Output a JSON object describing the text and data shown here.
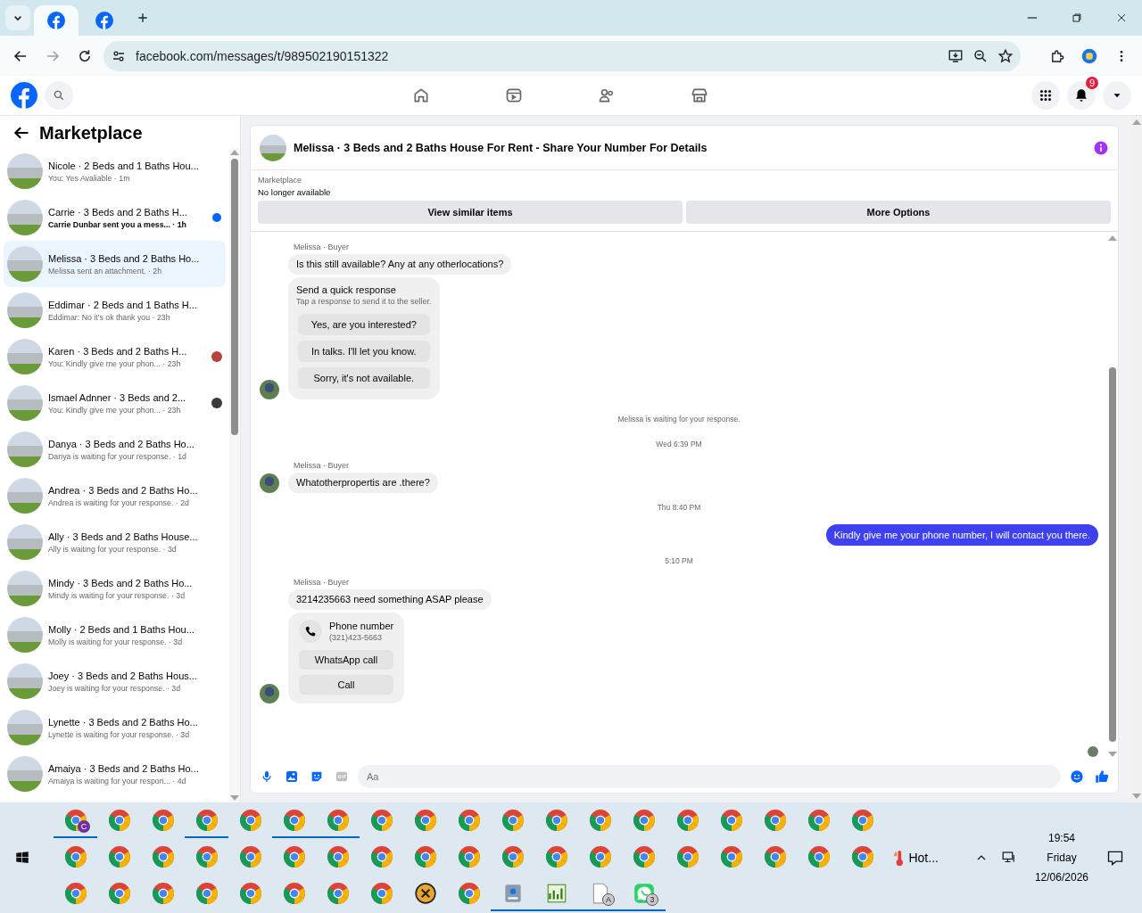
{
  "browser": {
    "tabs": [
      {
        "selected": true
      },
      {
        "selected": false
      }
    ],
    "url": "facebook.com/messages/t/989502190151322"
  },
  "fb_header": {
    "notifications_badge": "9"
  },
  "sidebar": {
    "title": "Marketplace",
    "items": [
      {
        "title": "Nicole · 2 Beds and 1 Baths Hou...",
        "preview": "You: Yes Avaliable · 1m",
        "selected": false,
        "unread": false,
        "seen": false
      },
      {
        "title": "Carrie · 3 Beds and 2 Baths H...",
        "preview": "Carrie Dunbar sent you a mess... · 1h",
        "selected": false,
        "unread": true,
        "seen": false
      },
      {
        "title": "Melissa · 3 Beds and 2 Baths Ho...",
        "preview": "Melissa sent an attachment. · 2h",
        "selected": true,
        "unread": false,
        "seen": false
      },
      {
        "title": "Eddimar · 2 Beds and 1 Baths H...",
        "preview": "Eddimar: No it's ok thank you · 23h",
        "selected": false,
        "unread": false,
        "seen": false
      },
      {
        "title": "Karen · 3 Beds and 2 Baths H...",
        "preview": "You: Kindly give me your phon... · 23h",
        "selected": false,
        "unread": false,
        "seen": true,
        "color": "#b5453a"
      },
      {
        "title": "Ismael Adnner · 3 Beds and 2...",
        "preview": "You: Kindly give me your phon... · 23h",
        "selected": false,
        "unread": false,
        "seen": true,
        "color": "#3a3a3a"
      },
      {
        "title": "Danya · 3 Beds and 2 Baths Ho...",
        "preview": "Danya is waiting for your response. · 1d",
        "selected": false,
        "unread": false,
        "seen": false
      },
      {
        "title": "Andrea · 3 Beds and 2 Baths Ho...",
        "preview": "Andrea is waiting for your response. · 2d",
        "selected": false,
        "unread": false,
        "seen": false
      },
      {
        "title": "Ally · 3 Beds and 2 Baths House...",
        "preview": "Ally is waiting for your response. · 3d",
        "selected": false,
        "unread": false,
        "seen": false
      },
      {
        "title": "Mindy · 3 Beds and 2 Baths Ho...",
        "preview": "Mindy is waiting for your response. · 3d",
        "selected": false,
        "unread": false,
        "seen": false
      },
      {
        "title": "Molly · 2 Beds and 1 Baths Hou...",
        "preview": "Molly is waiting for your response. · 3d",
        "selected": false,
        "unread": false,
        "seen": false
      },
      {
        "title": "Joey · 3 Beds and 2 Baths Hous...",
        "preview": "Joey is waiting for your response. · 3d",
        "selected": false,
        "unread": false,
        "seen": false
      },
      {
        "title": "Lynette · 3 Beds and 2 Baths Ho...",
        "preview": "Lynette is waiting for your response. · 3d",
        "selected": false,
        "unread": false,
        "seen": false
      },
      {
        "title": "Amaiya · 3 Beds and 2 Baths Ho...",
        "preview": "Amaiya is waiting for your respon... · 4d",
        "selected": false,
        "unread": false,
        "seen": false
      }
    ]
  },
  "chat": {
    "title": "Melissa · 3 Beds and 2 Baths House For Rent - Share Your Number For Details",
    "listing": {
      "label": "Marketplace",
      "status": "No longer available",
      "buttons": [
        "View similar items",
        "More Options"
      ]
    },
    "messages": [
      {
        "kind": "sender",
        "text": "Melissa · Buyer"
      },
      {
        "kind": "incoming",
        "text": "Is this still  available? Any at any otherlocations?",
        "avatar": false
      },
      {
        "kind": "quick_response",
        "title": "Send a quick response",
        "subtitle": "Tap a response to send it to the seller.",
        "options": [
          "Yes, are you interested?",
          "In talks. I'll let you know.",
          "Sorry, it's not available."
        ],
        "avatar": true
      },
      {
        "kind": "notice",
        "text": "Melissa is waiting for your response."
      },
      {
        "kind": "timestamp",
        "text": "Wed 6:39 PM"
      },
      {
        "kind": "sender",
        "text": "Melissa · Buyer"
      },
      {
        "kind": "incoming",
        "text": "Whatotherpropertis are .there?",
        "avatar": true
      },
      {
        "kind": "timestamp",
        "text": "Thu 8:40 PM"
      },
      {
        "kind": "outgoing",
        "text": "Kindly give me your phone number, I will contact you there."
      },
      {
        "kind": "timestamp",
        "text": "5:10 PM"
      },
      {
        "kind": "sender",
        "text": "Melissa · Buyer"
      },
      {
        "kind": "incoming",
        "text": "3214235663 need something ASAP please",
        "avatar": false
      },
      {
        "kind": "phone_card",
        "title": "Phone number",
        "number": "(321)423-5663",
        "options": [
          "WhatsApp call",
          "Call"
        ],
        "avatar": true
      }
    ],
    "composer": {
      "placeholder": "Aa"
    }
  },
  "taskbar": {
    "rows": [
      [
        {
          "kind": "chrome",
          "active": true,
          "badge": "C"
        },
        {
          "kind": "chrome",
          "active": false
        },
        {
          "kind": "chrome",
          "active": false
        },
        {
          "kind": "chrome",
          "active": true
        },
        {
          "kind": "chrome",
          "active": false
        },
        {
          "kind": "chrome",
          "active": true
        },
        {
          "kind": "chrome",
          "active": true
        },
        {
          "kind": "chrome",
          "active": false
        },
        {
          "kind": "chrome",
          "active": false
        },
        {
          "kind": "chrome",
          "active": false
        },
        {
          "kind": "chrome",
          "active": false
        },
        {
          "kind": "chrome",
          "active": false
        },
        {
          "kind": "chrome",
          "active": false
        },
        {
          "kind": "chrome",
          "active": false
        },
        {
          "kind": "chrome",
          "active": false
        },
        {
          "kind": "chrome",
          "active": false
        },
        {
          "kind": "chrome",
          "active": false
        },
        {
          "kind": "chrome",
          "active": false
        },
        {
          "kind": "chrome",
          "active": false
        }
      ],
      [
        {
          "kind": "chrome",
          "active": false
        },
        {
          "kind": "chrome",
          "active": false
        },
        {
          "kind": "chrome",
          "active": false
        },
        {
          "kind": "chrome",
          "active": false
        },
        {
          "kind": "chrome",
          "active": false
        },
        {
          "kind": "chrome",
          "active": false
        },
        {
          "kind": "chrome",
          "active": false
        },
        {
          "kind": "chrome",
          "active": false
        },
        {
          "kind": "chrome",
          "active": false
        },
        {
          "kind": "chrome",
          "active": false
        },
        {
          "kind": "chrome",
          "active": false
        },
        {
          "kind": "chrome",
          "active": false
        },
        {
          "kind": "chrome",
          "active": false
        },
        {
          "kind": "chrome",
          "active": false
        },
        {
          "kind": "chrome",
          "active": false
        },
        {
          "kind": "chrome",
          "active": false
        },
        {
          "kind": "chrome",
          "active": false
        },
        {
          "kind": "chrome",
          "active": false
        },
        {
          "kind": "chrome",
          "active": false
        }
      ],
      [
        {
          "kind": "chrome",
          "active": false
        },
        {
          "kind": "chrome",
          "active": false
        },
        {
          "kind": "chrome",
          "active": false
        },
        {
          "kind": "chrome",
          "active": false
        },
        {
          "kind": "chrome",
          "active": false
        },
        {
          "kind": "chrome",
          "active": false
        },
        {
          "kind": "chrome",
          "active": false
        },
        {
          "kind": "chrome",
          "active": false
        },
        {
          "kind": "onex",
          "active": false
        },
        {
          "kind": "chrome",
          "active": false
        },
        {
          "kind": "drive",
          "active": true
        },
        {
          "kind": "chart",
          "active": true
        },
        {
          "kind": "document",
          "active": true,
          "badge": "A"
        },
        {
          "kind": "whatsapp",
          "active": true,
          "badge": "3"
        }
      ]
    ],
    "weather": "Hot...",
    "time": "19:54",
    "day": "Friday",
    "date": "12/06/2026"
  }
}
